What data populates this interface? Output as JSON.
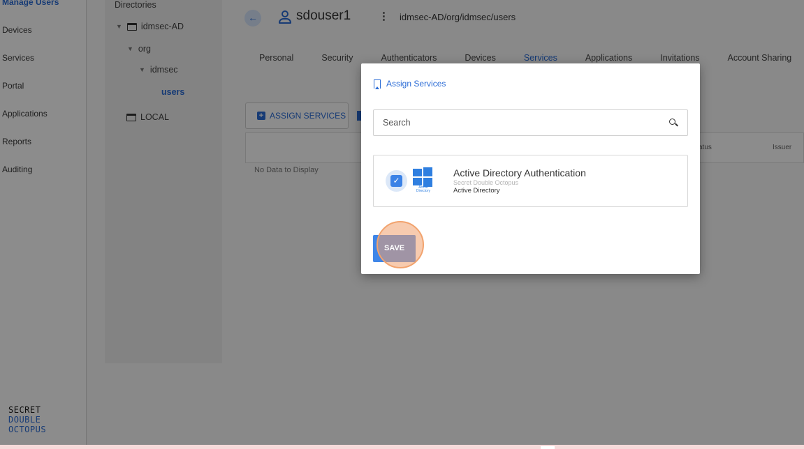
{
  "sidebar": {
    "items": [
      {
        "label": "Manage Users"
      },
      {
        "label": "Devices"
      },
      {
        "label": "Services"
      },
      {
        "label": "Portal"
      },
      {
        "label": "Applications"
      },
      {
        "label": "Reports"
      },
      {
        "label": "Auditing"
      }
    ],
    "logo": {
      "line1": "SECRET",
      "line2": "DOUBLE",
      "line3": "OCTOPUS"
    }
  },
  "directories": {
    "title": "Directories",
    "tree": [
      {
        "label": "idmsec-AD"
      },
      {
        "label": "org"
      },
      {
        "label": "idmsec"
      },
      {
        "label": "users"
      },
      {
        "label": "LOCAL"
      }
    ]
  },
  "header": {
    "back_icon": "arrow-left-icon",
    "user_icon": "user-icon",
    "user_name": "sdouser1",
    "path": "idmsec-AD/org/idmsec/users"
  },
  "tabs": [
    {
      "label": "Personal"
    },
    {
      "label": "Security"
    },
    {
      "label": "Authenticators"
    },
    {
      "label": "Devices"
    },
    {
      "label": "Services",
      "active": true
    },
    {
      "label": "Applications"
    },
    {
      "label": "Invitations"
    },
    {
      "label": "Account Sharing"
    }
  ],
  "services_page": {
    "assign_button_label": "ASSIGN SERVICES",
    "columns": {
      "status": "atus",
      "issuer": "Issuer"
    },
    "empty_text": "No Data to Display"
  },
  "modal": {
    "title": "Assign Services",
    "search": {
      "placeholder": "Search",
      "value": ""
    },
    "services": [
      {
        "name": "Active Directory Authentication",
        "vendor": "Secret Double Octopus",
        "type": "Active Directory",
        "logo_caption": "Active Directory",
        "checked": true
      }
    ],
    "save_label": "SAVE"
  },
  "colors": {
    "accent": "#2b6cd6",
    "button": "#3f86e8",
    "click_highlight": "#f2a36e"
  }
}
